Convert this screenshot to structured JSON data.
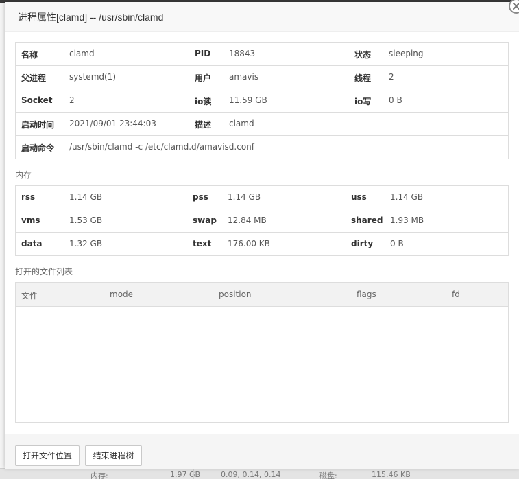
{
  "dialog": {
    "title": "进程属性[clamd] -- /usr/sbin/clamd"
  },
  "basic": {
    "rows": [
      [
        {
          "label": "名称",
          "value": "clamd"
        },
        {
          "label": "PID",
          "value": "18843"
        },
        {
          "label": "状态",
          "value": "sleeping"
        }
      ],
      [
        {
          "label": "父进程",
          "value": "systemd(1)"
        },
        {
          "label": "用户",
          "value": "amavis"
        },
        {
          "label": "线程",
          "value": "2"
        }
      ],
      [
        {
          "label": "Socket",
          "value": "2"
        },
        {
          "label": "io读",
          "value": "11.59 GB"
        },
        {
          "label": "io写",
          "value": "0 B"
        }
      ],
      [
        {
          "label": "启动时间",
          "value": "2021/09/01 23:44:03"
        },
        {
          "label": "描述",
          "value": "clamd"
        }
      ],
      [
        {
          "label": "启动命令",
          "value": "/usr/sbin/clamd -c /etc/clamd.d/amavisd.conf"
        }
      ]
    ]
  },
  "memory": {
    "section_title": "内存",
    "rows": [
      [
        {
          "label": "rss",
          "value": "1.14 GB"
        },
        {
          "label": "pss",
          "value": "1.14 GB"
        },
        {
          "label": "uss",
          "value": "1.14 GB"
        }
      ],
      [
        {
          "label": "vms",
          "value": "1.53 GB"
        },
        {
          "label": "swap",
          "value": "12.84 MB"
        },
        {
          "label": "shared",
          "value": "1.93 MB"
        }
      ],
      [
        {
          "label": "data",
          "value": "1.32 GB"
        },
        {
          "label": "text",
          "value": "176.00 KB"
        },
        {
          "label": "dirty",
          "value": "0 B"
        }
      ]
    ]
  },
  "files": {
    "section_title": "打开的文件列表",
    "columns": [
      "文件",
      "mode",
      "position",
      "flags",
      "fd"
    ]
  },
  "footer": {
    "open_location_label": "打开文件位置",
    "kill_tree_label": "结束进程树"
  },
  "background": {
    "footer_text": [
      "内存:",
      "1.97 GB",
      "0.09, 0.14, 0.14",
      "磁盘:",
      "115.46 KB"
    ]
  }
}
